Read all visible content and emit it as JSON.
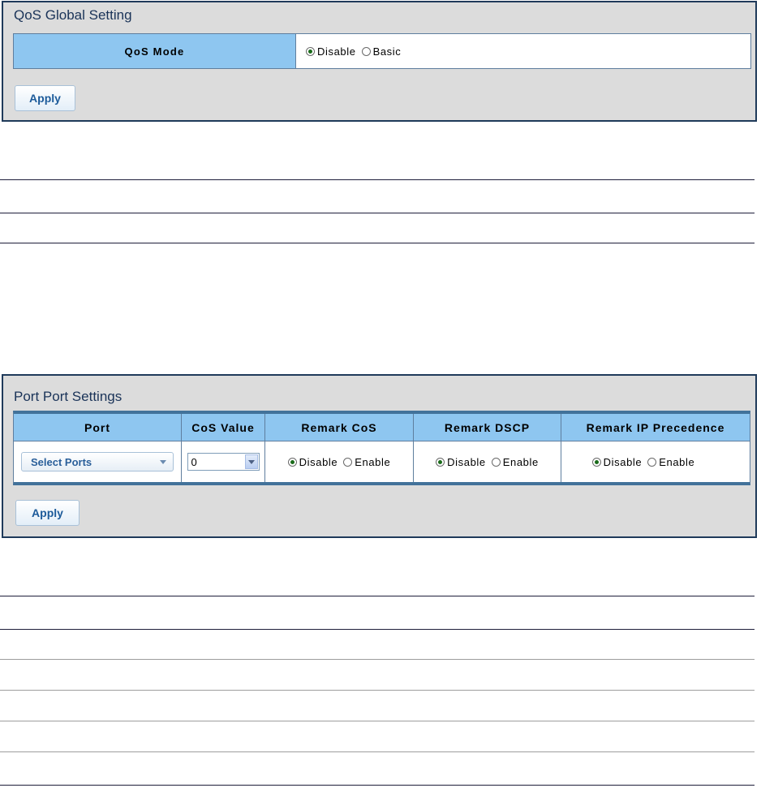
{
  "qos_global": {
    "title": "QoS Global Setting",
    "mode_header": "QoS Mode",
    "options": [
      {
        "label": "Disable",
        "selected": true
      },
      {
        "label": "Basic",
        "selected": false
      }
    ],
    "apply_label": "Apply"
  },
  "port_settings": {
    "title": "Port Port Settings",
    "headers": [
      "Port",
      "CoS Value",
      "Remark CoS",
      "Remark DSCP",
      "Remark IP Precedence"
    ],
    "port_select_label": "Select Ports",
    "cos_value": "0",
    "remark_cos": [
      {
        "label": "Disable",
        "selected": true
      },
      {
        "label": "Enable",
        "selected": false
      }
    ],
    "remark_dscp": [
      {
        "label": "Disable",
        "selected": true
      },
      {
        "label": "Enable",
        "selected": false
      }
    ],
    "remark_ip_precedence": [
      {
        "label": "Disable",
        "selected": true
      },
      {
        "label": "Enable",
        "selected": false
      }
    ],
    "apply_label": "Apply"
  },
  "colors": {
    "panel_bg": "#dcdcdc",
    "header_bg": "#8ec6f0",
    "title_text": "#1a3358",
    "button_text": "#1d5b9a"
  }
}
